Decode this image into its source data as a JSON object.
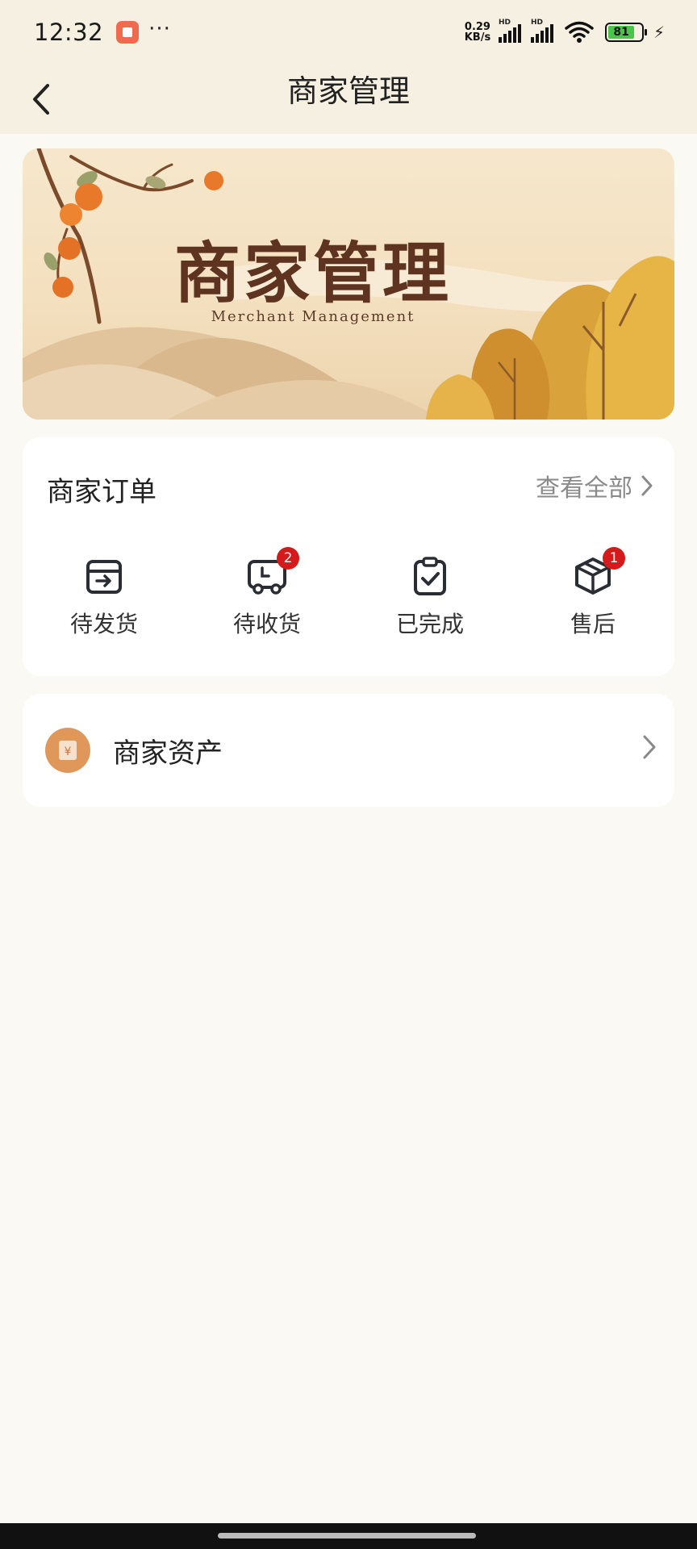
{
  "status_bar": {
    "time": "12:32",
    "dots": "···",
    "net_speed_value": "0.29",
    "net_speed_unit": "KB/s",
    "signal_label_1": "HD",
    "signal_label_2": "HD",
    "battery_level": "81",
    "icons": [
      "app-notification-icon",
      "signal-icon",
      "wifi-icon",
      "battery-icon",
      "charging-icon"
    ]
  },
  "header": {
    "title": "商家管理",
    "back_icon": "back-arrow-icon"
  },
  "banner": {
    "title": "商家管理",
    "subtitle": "Merchant Management"
  },
  "orders": {
    "title": "商家订单",
    "view_all": "查看全部",
    "items": [
      {
        "label": "待发货",
        "icon": "pending-shipment-icon",
        "badge": ""
      },
      {
        "label": "待收货",
        "icon": "pending-receipt-truck-icon",
        "badge": "2"
      },
      {
        "label": "已完成",
        "icon": "completed-clipboard-icon",
        "badge": ""
      },
      {
        "label": "售后",
        "icon": "after-sales-box-icon",
        "badge": "1"
      }
    ]
  },
  "assets": {
    "label": "商家资产",
    "icon_symbol": "¥"
  },
  "colors": {
    "header_bg": "#f5f0e1",
    "page_bg": "#fbf9f4",
    "badge": "#d41a1a",
    "asset_icon": "#e0975a",
    "banner_text": "#5e3420"
  }
}
